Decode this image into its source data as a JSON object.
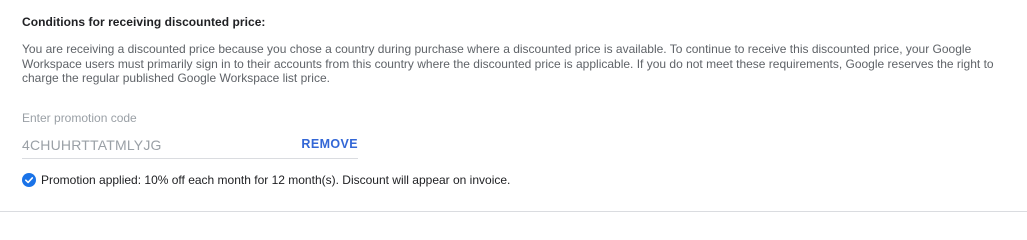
{
  "conditions": {
    "title": "Conditions for receiving discounted price:",
    "body": "You are receiving a discounted price because you chose a country during purchase where a discounted price is available. To continue to receive this discounted price, your Google Workspace users must primarily sign in to their accounts from this country where the discounted price is applicable. If you do not meet these requirements, Google reserves the right to charge the regular published Google Workspace list price."
  },
  "promotion": {
    "label": "Enter promotion code",
    "code": "4CHUHRTTATMLYJG",
    "remove_label": "REMOVE",
    "status_icon": "check-circle-icon",
    "status_text": "Promotion applied: 10% off each month for 12 month(s). Discount will appear on invoice."
  },
  "colors": {
    "accent": "#3367d6",
    "check": "#1a73e8",
    "muted_text": "#5f6368",
    "placeholder_text": "#9aa0a6"
  }
}
